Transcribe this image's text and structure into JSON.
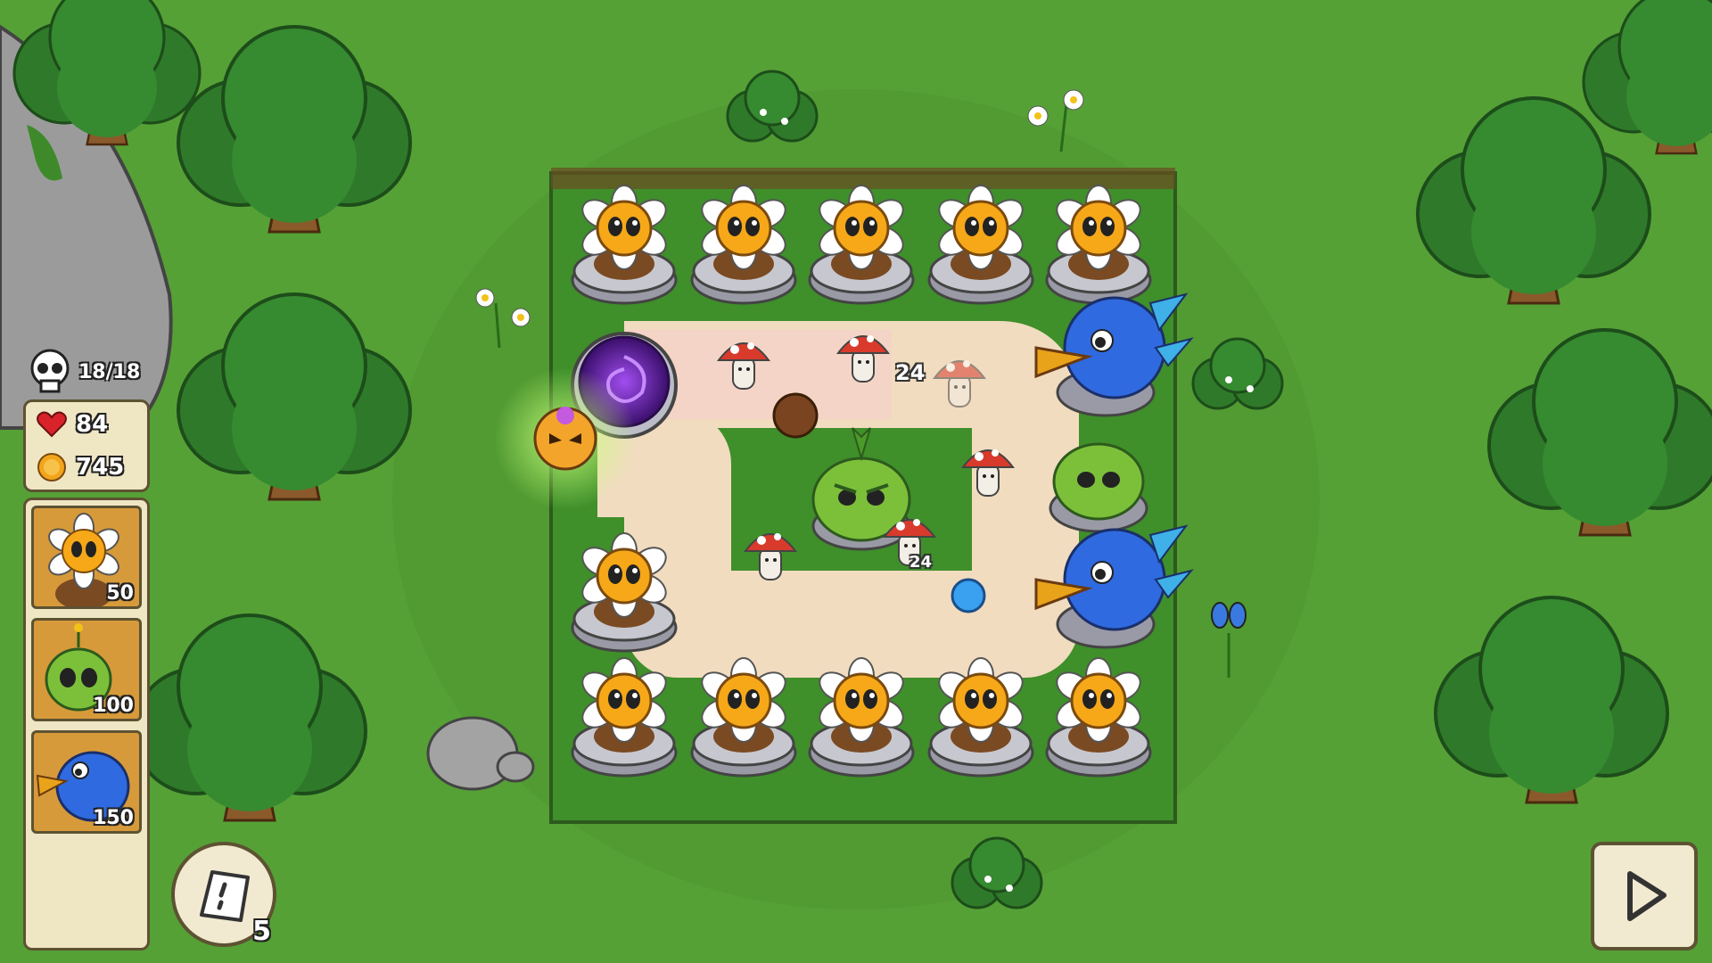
{
  "hud": {
    "wave_counter": "18/18",
    "lives": "84",
    "coins": "745"
  },
  "shop": {
    "items": [
      {
        "icon": "sunflower-tower-icon",
        "price": "50"
      },
      {
        "icon": "green-sprout-tower-icon",
        "price": "100"
      },
      {
        "icon": "blue-bird-tower-icon",
        "price": "150"
      }
    ]
  },
  "tools": {
    "shovel_count": "5",
    "play_icon": "play-icon"
  },
  "damage_numbers": [
    "24",
    "24"
  ],
  "colors": {
    "grass": "#4f9a32",
    "path": "#f1dcc0",
    "panel": "#efe6c4",
    "panel_border": "#5d5232",
    "card": "#d79a3a",
    "portal": "#6a2aa8"
  }
}
